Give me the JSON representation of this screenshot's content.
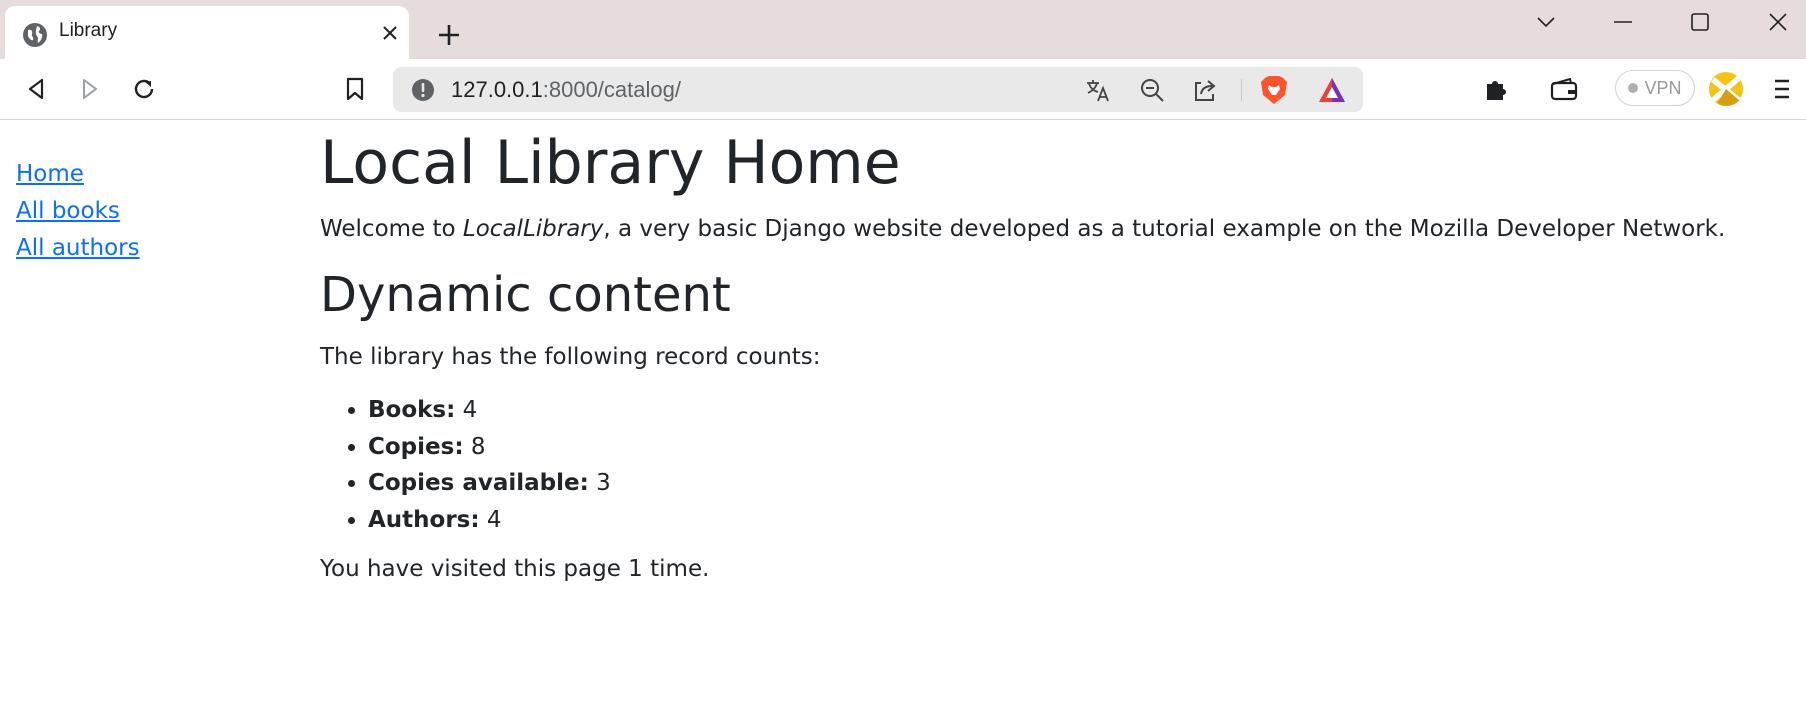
{
  "browser": {
    "tab": {
      "title": "Library",
      "favicon": "globe-icon"
    },
    "url_host": "127.0.0.1",
    "url_rest": ":8000/catalog/",
    "vpn_label": "VPN"
  },
  "sidebar": {
    "links": [
      {
        "label": "Home"
      },
      {
        "label": "All books"
      },
      {
        "label": "All authors"
      }
    ]
  },
  "main": {
    "title": "Local Library Home",
    "welcome_prefix": "Welcome to ",
    "welcome_em": "LocalLibrary",
    "welcome_suffix": ", a very basic Django website developed as a tutorial example on the Mozilla Developer Network.",
    "section_title": "Dynamic content",
    "counts_intro": "The library has the following record counts:",
    "counts": [
      {
        "label": "Books:",
        "value": "4"
      },
      {
        "label": "Copies:",
        "value": "8"
      },
      {
        "label": "Copies available:",
        "value": "3"
      },
      {
        "label": "Authors:",
        "value": "4"
      }
    ],
    "visits": "You have visited this page 1 time."
  },
  "colors": {
    "link": "#0d6efd",
    "tabstrip": "#e5dcdb",
    "text": "#212529"
  }
}
